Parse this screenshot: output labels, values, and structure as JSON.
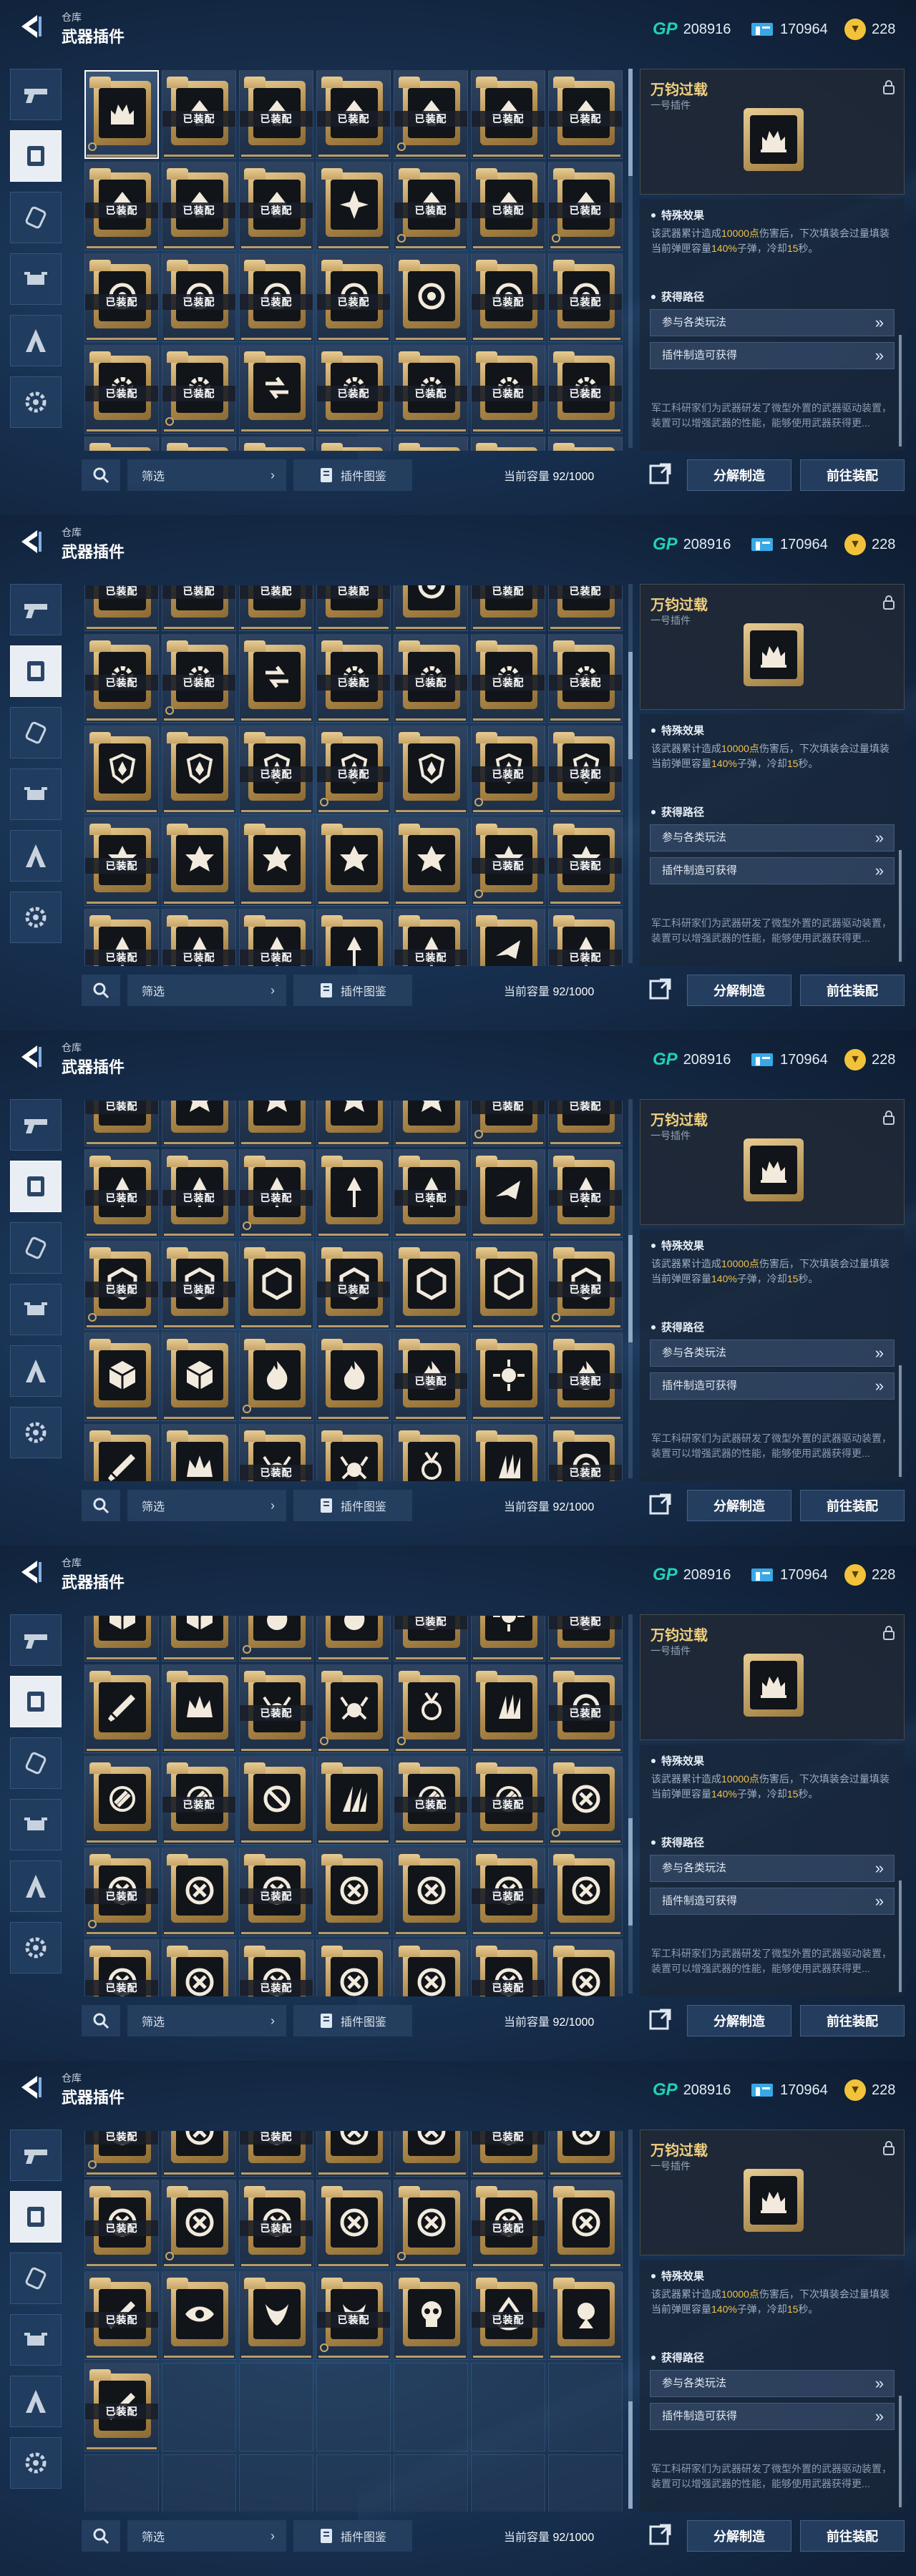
{
  "frames": 5,
  "header": {
    "breadcrumb": "仓库",
    "title": "武器插件"
  },
  "currency": {
    "gp_label": "GP",
    "gp_value": "208916",
    "ticket_value": "170964",
    "coin_value": "228"
  },
  "sidebar_icons": [
    "pistol-icon",
    "plugin-icon",
    "attachment-icon",
    "drone-icon",
    "emblem-icon",
    "gear-badge-icon"
  ],
  "equipped_label": "已装配",
  "bottom": {
    "filter_label": "筛选",
    "atlas_label": "插件图鉴",
    "capacity_label": "当前容量",
    "capacity_value": "92/1000"
  },
  "detail": {
    "name": "万钧过载",
    "subtitle": "一号插件",
    "effect_title": "特殊效果",
    "effect_parts": [
      "该武器累计造成",
      "10000点",
      "伤害后，下次填装会过量填装当前弹匣容量",
      "140%",
      "子弹，冷却",
      "15",
      "秒。"
    ],
    "source_title": "获得路径",
    "sources": [
      "参与各类玩法",
      "插件制造可获得"
    ],
    "desc": "军工科研家们为武器研发了微型外置的武器驱动装置，",
    "desc2": "装置可以增强武器的性能，能够使用武器获得更..."
  },
  "actions": {
    "disassemble": "分解制造",
    "equip": "前往装配"
  },
  "frame_offsets_rows": [
    0,
    3,
    6,
    9,
    12
  ],
  "items": [
    {
      "icon": "castle",
      "eq": false,
      "sel": true
    },
    {
      "icon": "arrow",
      "eq": true
    },
    {
      "icon": "arrow",
      "eq": true
    },
    {
      "icon": "arrow",
      "eq": true
    },
    {
      "icon": "arrow",
      "eq": true
    },
    {
      "icon": "arrow",
      "eq": true
    },
    {
      "icon": "arrow",
      "eq": true
    },
    {
      "icon": "arrow",
      "eq": true
    },
    {
      "icon": "arrow",
      "eq": true
    },
    {
      "icon": "arrow",
      "eq": true
    },
    {
      "icon": "spark",
      "eq": false
    },
    {
      "icon": "arrow",
      "eq": true
    },
    {
      "icon": "arrow",
      "eq": true
    },
    {
      "icon": "arrow",
      "eq": true
    },
    {
      "icon": "ring",
      "eq": true
    },
    {
      "icon": "ring",
      "eq": true
    },
    {
      "icon": "ring",
      "eq": true
    },
    {
      "icon": "ring",
      "eq": true
    },
    {
      "icon": "ring",
      "eq": false
    },
    {
      "icon": "ring",
      "eq": true
    },
    {
      "icon": "ring",
      "eq": true
    },
    {
      "icon": "gear",
      "eq": true
    },
    {
      "icon": "gear",
      "eq": true
    },
    {
      "icon": "flow",
      "eq": false
    },
    {
      "icon": "gear",
      "eq": true
    },
    {
      "icon": "gear",
      "eq": true
    },
    {
      "icon": "gear",
      "eq": true
    },
    {
      "icon": "gear",
      "eq": true
    },
    {
      "icon": "shield",
      "eq": false
    },
    {
      "icon": "shield",
      "eq": false
    },
    {
      "icon": "shield",
      "eq": true
    },
    {
      "icon": "shield",
      "eq": true
    },
    {
      "icon": "shield",
      "eq": false
    },
    {
      "icon": "shield",
      "eq": true
    },
    {
      "icon": "shield",
      "eq": true
    },
    {
      "icon": "star",
      "eq": true
    },
    {
      "icon": "star",
      "eq": false
    },
    {
      "icon": "star",
      "eq": false
    },
    {
      "icon": "star",
      "eq": false
    },
    {
      "icon": "star",
      "eq": false
    },
    {
      "icon": "star",
      "eq": true
    },
    {
      "icon": "star",
      "eq": true
    },
    {
      "icon": "spear",
      "eq": true
    },
    {
      "icon": "spear",
      "eq": true
    },
    {
      "icon": "spear",
      "eq": true
    },
    {
      "icon": "spear",
      "eq": false
    },
    {
      "icon": "spear",
      "eq": true
    },
    {
      "icon": "plane",
      "eq": false
    },
    {
      "icon": "spear",
      "eq": true
    },
    {
      "icon": "hex",
      "eq": true
    },
    {
      "icon": "hex",
      "eq": true
    },
    {
      "icon": "hex",
      "eq": false
    },
    {
      "icon": "hex",
      "eq": true
    },
    {
      "icon": "hex",
      "eq": false
    },
    {
      "icon": "hex",
      "eq": false
    },
    {
      "icon": "hex",
      "eq": true
    },
    {
      "icon": "cube",
      "eq": false
    },
    {
      "icon": "cube",
      "eq": false
    },
    {
      "icon": "flame",
      "eq": false
    },
    {
      "icon": "flame",
      "eq": false
    },
    {
      "icon": "flame",
      "eq": true
    },
    {
      "icon": "burst",
      "eq": false
    },
    {
      "icon": "flame",
      "eq": true
    },
    {
      "icon": "sword",
      "eq": false
    },
    {
      "icon": "crown",
      "eq": false
    },
    {
      "icon": "crab",
      "eq": true
    },
    {
      "icon": "crab",
      "eq": false
    },
    {
      "icon": "medal",
      "eq": false
    },
    {
      "icon": "claw",
      "eq": false
    },
    {
      "icon": "ring",
      "eq": true
    },
    {
      "icon": "link",
      "eq": false
    },
    {
      "icon": "link",
      "eq": true
    },
    {
      "icon": "nosign",
      "eq": false
    },
    {
      "icon": "claws",
      "eq": false
    },
    {
      "icon": "link",
      "eq": true
    },
    {
      "icon": "link",
      "eq": true
    },
    {
      "icon": "xcircle",
      "eq": false
    },
    {
      "icon": "xcircle",
      "eq": true
    },
    {
      "icon": "xcircle",
      "eq": false
    },
    {
      "icon": "xcircle",
      "eq": true
    },
    {
      "icon": "xcircle",
      "eq": false
    },
    {
      "icon": "xcircle",
      "eq": false
    },
    {
      "icon": "xcircle",
      "eq": true
    },
    {
      "icon": "xcircle",
      "eq": false
    },
    {
      "icon": "xcircle",
      "eq": true
    },
    {
      "icon": "xcircle",
      "eq": false
    },
    {
      "icon": "xcircle",
      "eq": true
    },
    {
      "icon": "xcircle",
      "eq": false
    },
    {
      "icon": "xcircle",
      "eq": false
    },
    {
      "icon": "xcircle",
      "eq": true
    },
    {
      "icon": "xcircle",
      "eq": false
    },
    {
      "icon": "sword",
      "eq": true
    },
    {
      "icon": "eye",
      "eq": false
    },
    {
      "icon": "horn",
      "eq": false
    },
    {
      "icon": "horn",
      "eq": true
    },
    {
      "icon": "skull",
      "eq": false
    },
    {
      "icon": "drop",
      "eq": true
    },
    {
      "icon": "orb",
      "eq": false
    },
    {
      "icon": "sword",
      "eq": true
    }
  ]
}
